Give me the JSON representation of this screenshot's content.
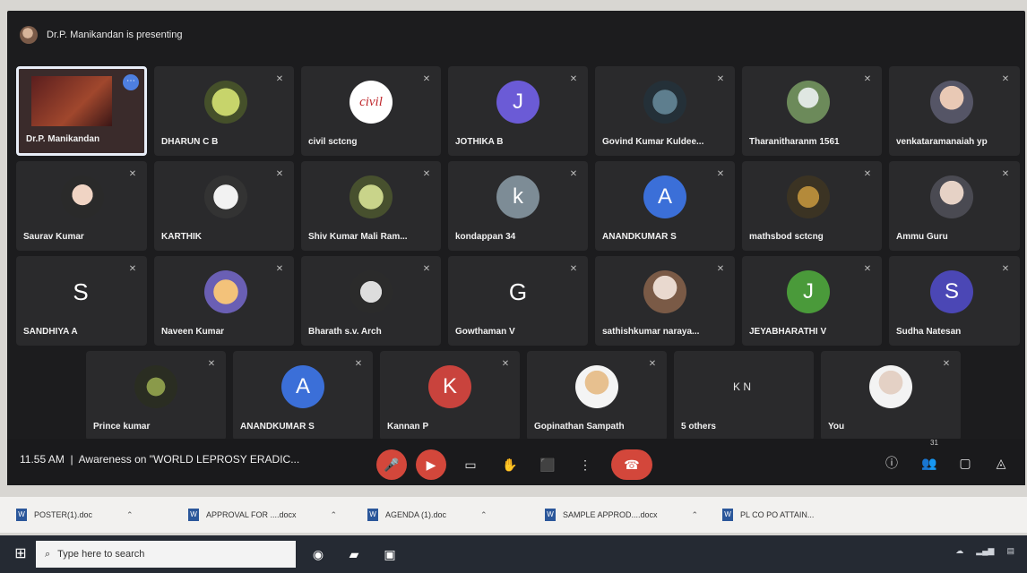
{
  "meeting": {
    "presenting_text": "Dr.P. Manikandan is presenting",
    "time": "11.55 AM",
    "title": "Awareness on \"WORLD LEPROSY ERADIC...",
    "people_count": "31"
  },
  "participants_row1": [
    {
      "name": "Dr.P. Manikandan",
      "presenter": true
    },
    {
      "name": "DHARUN C B",
      "initial": "",
      "avatar": "photo"
    },
    {
      "name": "civil sctcng",
      "initial": "civil",
      "avatar": "logo"
    },
    {
      "name": "JOTHIKA B",
      "initial": "J",
      "color": "#6b5bd6"
    },
    {
      "name": "Govind Kumar Kuldee...",
      "initial": "",
      "avatar": "photo"
    },
    {
      "name": "Tharanitharanm 1561",
      "initial": "",
      "avatar": "photo"
    },
    {
      "name": "venkataramanaiah yp",
      "initial": "",
      "avatar": "photo"
    }
  ],
  "participants_row2": [
    {
      "name": "Saurav Kumar",
      "initial": "",
      "avatar": "photo"
    },
    {
      "name": "KARTHIK",
      "initial": "",
      "avatar": "photo"
    },
    {
      "name": "Shiv Kumar Mali Ram...",
      "initial": "",
      "avatar": "photo"
    },
    {
      "name": "kondappan 34",
      "initial": "k",
      "color": "#7d8c96"
    },
    {
      "name": "ANANDKUMAR S",
      "initial": "A",
      "color": "#3b6fd8"
    },
    {
      "name": "mathsbod sctcng",
      "initial": "",
      "avatar": "photo"
    },
    {
      "name": "Ammu Guru",
      "initial": "",
      "avatar": "photo"
    }
  ],
  "participants_row3": [
    {
      "name": "SANDHIYA A",
      "initial": "S",
      "color": "transparent"
    },
    {
      "name": "Naveen Kumar",
      "initial": "",
      "avatar": "photo"
    },
    {
      "name": "Bharath s.v. Arch",
      "initial": "",
      "avatar": "photo"
    },
    {
      "name": "Gowthaman V",
      "initial": "G",
      "color": "transparent"
    },
    {
      "name": "sathishkumar naraya...",
      "initial": "",
      "avatar": "photo"
    },
    {
      "name": "JEYABHARATHI V",
      "initial": "J",
      "color": "#4a9a3a"
    },
    {
      "name": "Sudha Natesan",
      "initial": "S",
      "color": "#4b47b5"
    }
  ],
  "participants_row4": [
    {
      "name": "Prince kumar",
      "initial": "",
      "avatar": "photo"
    },
    {
      "name": "ANANDKUMAR S",
      "initial": "A",
      "color": "#3b6fd8"
    },
    {
      "name": "Kannan P",
      "initial": "K",
      "color": "#c9433d"
    },
    {
      "name": "Gopinathan Sampath",
      "initial": "",
      "avatar": "photo"
    },
    {
      "name": "5 others",
      "initial": "K N",
      "color": "transparent"
    },
    {
      "name": "You",
      "initial": "",
      "avatar": "photo"
    }
  ],
  "controls": {
    "icons": [
      "mic-off-icon",
      "camera-off-icon",
      "captions-icon",
      "raise-hand-icon",
      "present-icon",
      "more-options-icon",
      "end-call-icon"
    ],
    "side_icons": [
      "info-icon",
      "people-icon",
      "chat-icon",
      "activities-icon"
    ],
    "accent_red": "#d3473b"
  },
  "downloads": [
    {
      "name": "POSTER(1).doc"
    },
    {
      "name": "APPROVAL FOR ....docx"
    },
    {
      "name": "AGENDA (1).doc"
    },
    {
      "name": "SAMPLE APPROD....docx"
    },
    {
      "name": "PL CO PO ATTAIN..."
    }
  ],
  "taskbar": {
    "search_placeholder": "Type here to search"
  }
}
